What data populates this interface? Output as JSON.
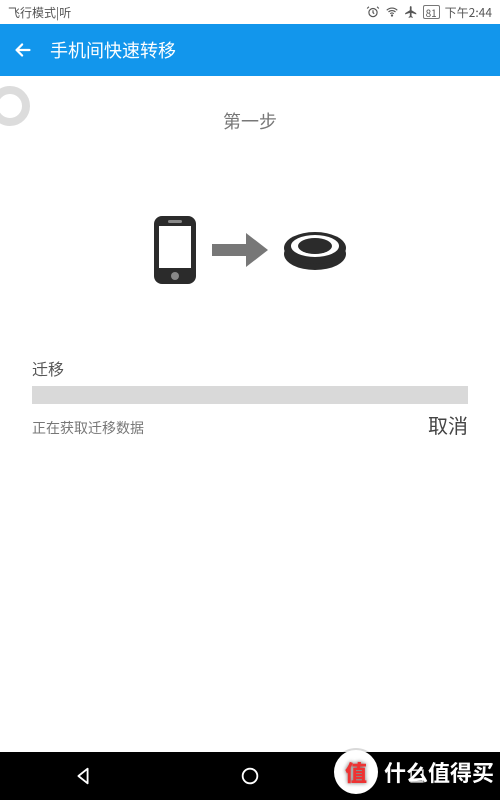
{
  "status_bar": {
    "flight_mode_label": "飞行模式|听",
    "battery_pct": "81",
    "time": "下午2:44"
  },
  "app_bar": {
    "title": "手机间快速转移"
  },
  "content": {
    "step_title": "第一步",
    "section_label": "迁移",
    "status_text": "正在获取迁移数据",
    "cancel_label": "取消"
  },
  "icons": {
    "phone": "phone-icon",
    "arrow": "arrow-right-icon",
    "disc": "disc-device-icon"
  },
  "watermark": {
    "badge": "值",
    "text": "什么值得买"
  },
  "colors": {
    "primary": "#1296ec",
    "progress_track": "#d9d9d9"
  }
}
